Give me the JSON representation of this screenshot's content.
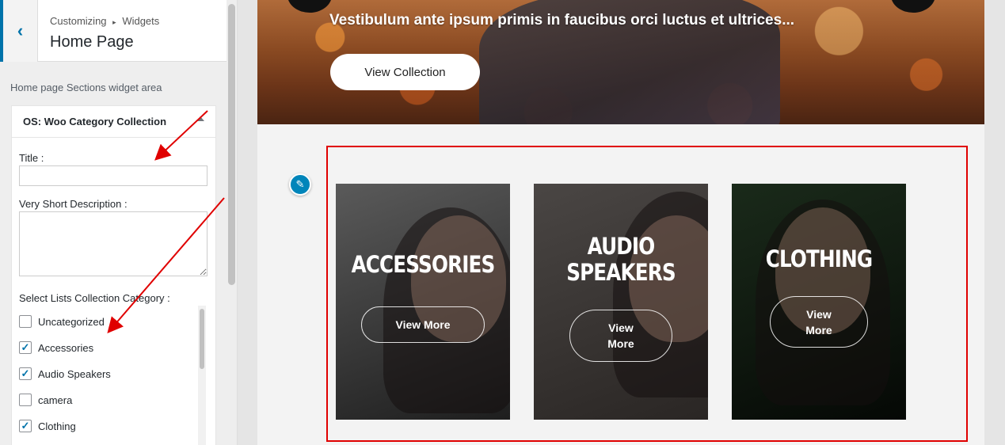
{
  "sidebar": {
    "breadcrumb_parent": "Customizing",
    "breadcrumb_separator": "▸",
    "breadcrumb_child": "Widgets",
    "section_title": "Home Page",
    "area_label": "Home page Sections widget area",
    "widget": {
      "title": "OS: Woo Category Collection",
      "title_label": "Title :",
      "title_value": "",
      "description_label": "Very Short Description :",
      "description_value": "",
      "category_label": "Select Lists Collection Category :",
      "categories": [
        {
          "label": "Uncategorized",
          "checked": false
        },
        {
          "label": "Accessories",
          "checked": true
        },
        {
          "label": "Audio Speakers",
          "checked": true
        },
        {
          "label": "camera",
          "checked": false
        },
        {
          "label": "Clothing",
          "checked": true
        }
      ]
    }
  },
  "preview": {
    "hero": {
      "text": "Vestibulum ante ipsum primis in faucibus orci luctus et ultrices...",
      "button_label": "View Collection"
    },
    "edit_icon": "pencil-icon",
    "cards": [
      {
        "title": "ACCESSORIES",
        "button": "View More"
      },
      {
        "title_line1": "AUDIO",
        "title_line2": "SPEAKERS",
        "button_line1": "View",
        "button_line2": "More"
      },
      {
        "title": "CLOTHING",
        "button_line1": "View",
        "button_line2": "More"
      }
    ]
  },
  "colors": {
    "accent": "#0073aa",
    "highlight_border": "#e00000",
    "annotation_arrow": "#e00000"
  }
}
